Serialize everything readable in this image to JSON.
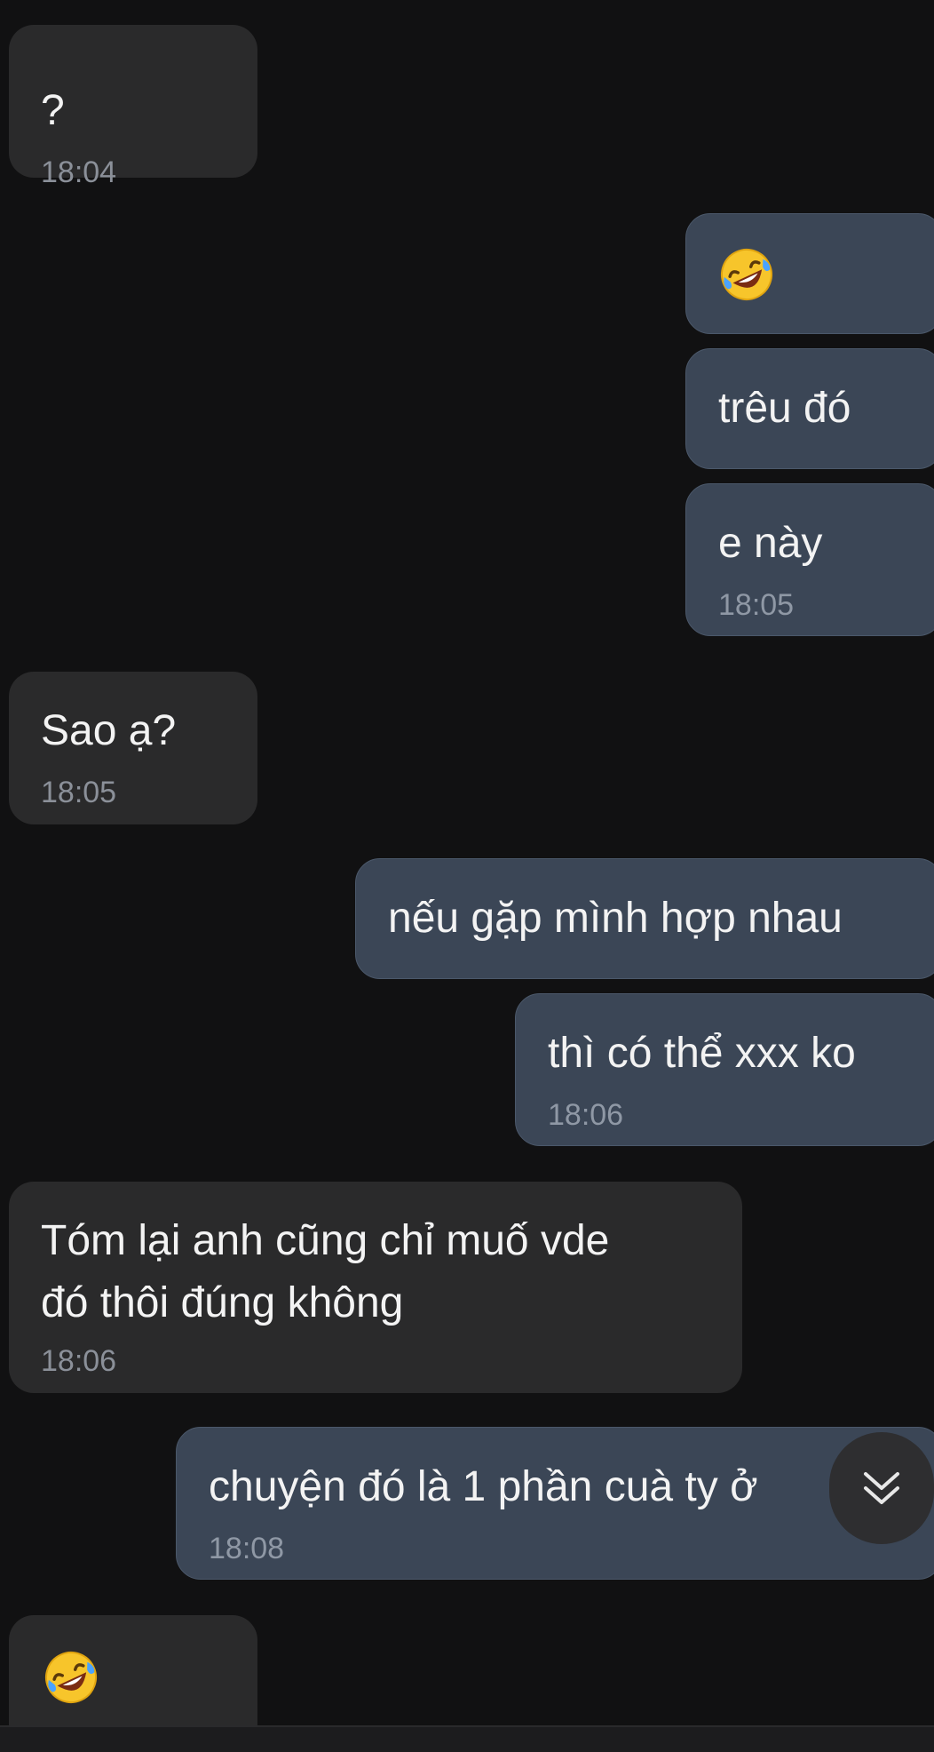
{
  "messages": [
    {
      "side": "in",
      "text": "?",
      "time": "18:04"
    },
    {
      "side": "out",
      "emoji": "rofl",
      "text": "",
      "time": ""
    },
    {
      "side": "out",
      "text": "trêu đó",
      "time": ""
    },
    {
      "side": "out",
      "text": "e này",
      "time": "18:05"
    },
    {
      "side": "in",
      "text": "Sao ạ?",
      "time": "18:05"
    },
    {
      "side": "out",
      "text": "nếu gặp mình hợp nhau",
      "time": ""
    },
    {
      "side": "out",
      "text": "thì có thể xxx ko",
      "time": "18:06"
    },
    {
      "side": "in",
      "text_line1": "Tóm lại anh cũng chỉ muố vde",
      "text_line2": "đó thôi đúng không",
      "time": "18:06"
    },
    {
      "side": "out",
      "text": "chuyện đó là 1 phần cuà ty ở",
      "time": "18:08"
    },
    {
      "side": "in",
      "emoji": "rofl",
      "text": "",
      "time": ""
    }
  ],
  "icons": {
    "emoji": "rolling-on-floor-laughing-emoji",
    "scroll_down": "double-chevron-down-icon"
  },
  "colors": {
    "background": "#111112",
    "incoming_bubble": "#2a2a2b",
    "outgoing_bubble": "#3b4656"
  }
}
